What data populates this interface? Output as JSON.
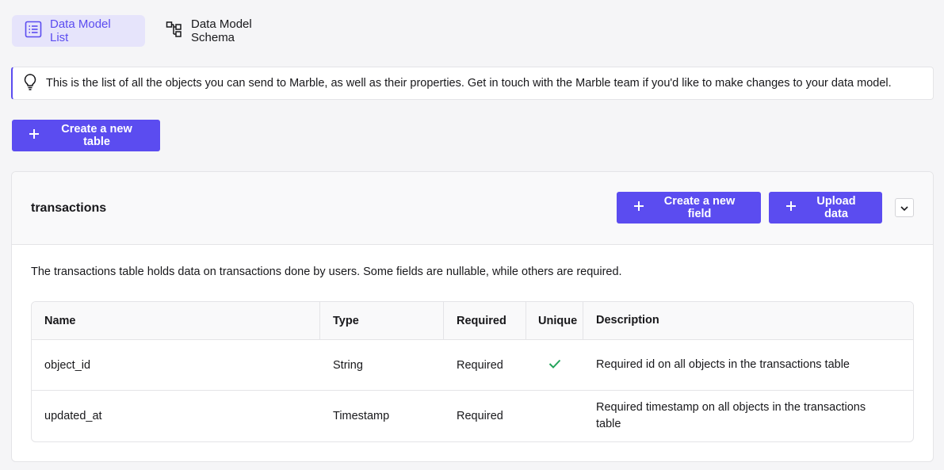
{
  "tabs": [
    {
      "label": "Data Model List",
      "icon": "list-icon",
      "active": true
    },
    {
      "label": "Data Model Schema",
      "icon": "schema-icon",
      "active": false
    }
  ],
  "callout": {
    "icon": "lightbulb-icon",
    "text": "This is the list of all the objects you can send to Marble, as well as their properties. Get in touch with the Marble team if you'd like to make changes to your data model."
  },
  "create_table_label": "Create a new table",
  "table_card": {
    "title": "transactions",
    "create_field_label": "Create a new field",
    "upload_label": "Upload data",
    "description": "The transactions table holds data on transactions done by users. Some fields are nullable, while others are required.",
    "columns": [
      "Name",
      "Type",
      "Required",
      "Unique",
      "Description"
    ],
    "rows": [
      {
        "name": "object_id",
        "type": "String",
        "required": "Required",
        "unique": true,
        "description": "Required id on all objects in the transactions table"
      },
      {
        "name": "updated_at",
        "type": "Timestamp",
        "required": "Required",
        "unique": false,
        "description": "Required timestamp on all objects in the transactions table"
      }
    ]
  },
  "colors": {
    "accent": "#5b4cf0",
    "check": "#22a35a"
  }
}
